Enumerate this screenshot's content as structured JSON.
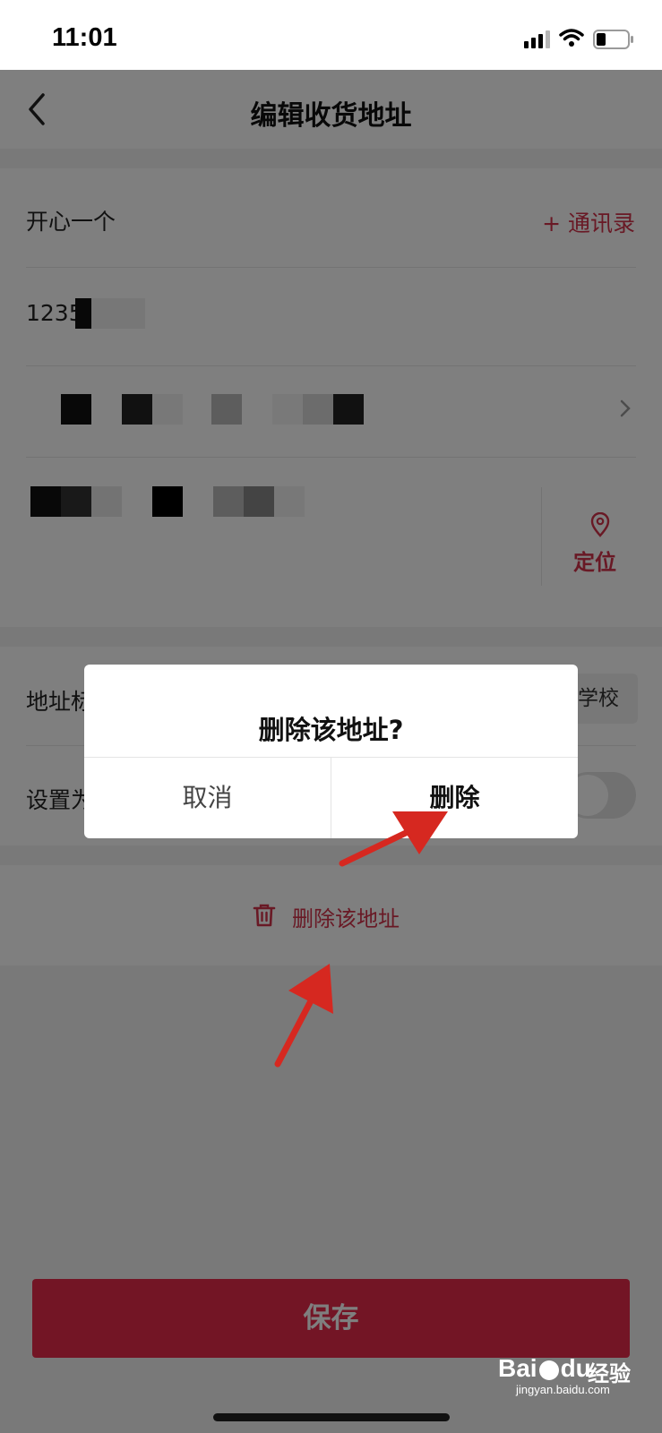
{
  "status_bar": {
    "time": "11:01"
  },
  "nav": {
    "title": "编辑收货地址"
  },
  "form": {
    "name_value": "开心一个",
    "contacts_label": "+ 通讯录",
    "phone_value": "1235",
    "locate_label": "定位",
    "tag_label": "地址标",
    "tag_chip": "学校",
    "default_label": "设置为"
  },
  "delete_address_label": "删除该地址",
  "save_label": "保存",
  "dialog": {
    "title": "删除该地址?",
    "cancel": "取消",
    "confirm": "删除"
  },
  "watermark": {
    "logo": "Bai",
    "logo2": "du",
    "cn": "经验",
    "url": "jingyan.baidu.com"
  },
  "colors": {
    "accent": "#e62b4a",
    "annotation_arrow": "#d62820"
  }
}
